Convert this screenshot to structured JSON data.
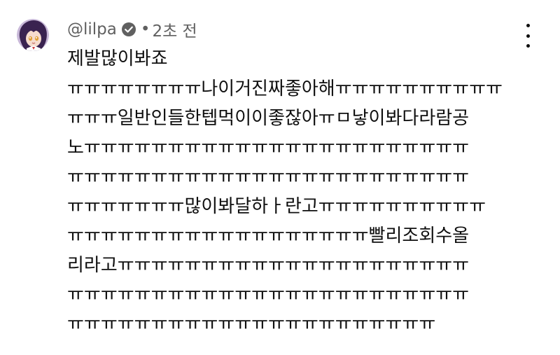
{
  "comment": {
    "handle": "@lilpa",
    "separator": "•",
    "timestamp": "2초 전",
    "avatar_icon": "avatar-icon",
    "verified_icon": "verified-check-icon",
    "more_icon": "more-vert-icon",
    "lines": [
      "제발많이봐죠",
      "ㅠㅠㅠㅠㅠㅠㅠㅠ나이거진짜좋아해ㅠㅠㅠㅠㅠㅠㅠㅠㅠㅠ",
      "ㅠㅠㅠ일반인들한텝먹이이좋잖아ㅠㅁ낳이봐다라람공",
      "노ㅠㅠㅠㅠㅠㅠㅠㅠㅠㅠㅠㅠㅠㅠㅠㅠㅠㅠㅠㅠㅠㅠㅠ",
      "ㅠㅠㅠㅠㅠㅠㅠㅠㅠㅠㅠㅠㅠㅠㅠㅠㅠㅠㅠㅠㅠㅠㅠㅠ",
      "ㅠㅠㅠㅠㅠㅠㅠ많이봐달하ㅏ란고ㅠㅠㅠㅠㅠㅠㅠㅠㅠㅠ",
      "ㅠㅠㅠㅠㅠㅠㅠㅠㅠㅠㅠㅠㅠㅠㅠㅠㅠㅠ빨리조회수올",
      "리라고ㅠㅠㅠㅠㅠㅠㅠㅠㅠㅠㅠㅠㅠㅠㅠㅠㅠㅠㅠㅠㅠ",
      "ㅠㅠㅠㅠㅠㅠㅠㅠㅠㅠㅠㅠㅠㅠㅠㅠㅠㅠㅠㅠㅠㅠㅠㅠ",
      "ㅠㅠㅠㅠㅠㅠㅠㅠㅠㅠㅠㅠㅠㅠㅠㅠㅠㅠㅠㅠㅠㅠ"
    ]
  }
}
